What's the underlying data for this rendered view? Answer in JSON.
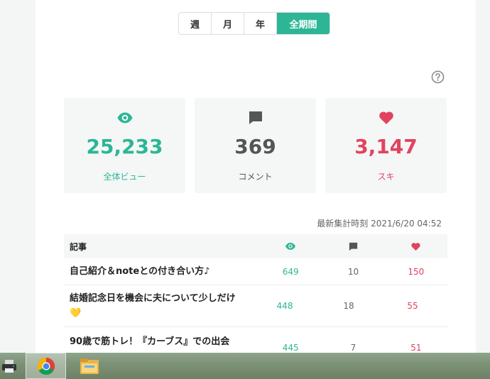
{
  "period_tabs": [
    {
      "label": "週",
      "active": false
    },
    {
      "label": "月",
      "active": false
    },
    {
      "label": "年",
      "active": false
    },
    {
      "label": "全期間",
      "active": true
    }
  ],
  "stats": {
    "views": {
      "value": "25,233",
      "label": "全体ビュー",
      "color": "#2cb696",
      "icon": "eye-icon"
    },
    "comments": {
      "value": "369",
      "label": "コメント",
      "color": "#555555",
      "icon": "comment-icon"
    },
    "likes": {
      "value": "3,147",
      "label": "スキ",
      "color": "#e0435f",
      "icon": "heart-icon"
    }
  },
  "timestamp": "最新集計時刻 2021/6/20 04:52",
  "table": {
    "header_title": "記事",
    "rows": [
      {
        "title": "自己紹介＆noteとの付き合い方♪",
        "views": "649",
        "comments": "10",
        "likes": "150"
      },
      {
        "title": "結婚記念日を機会に夫について少しだけ",
        "title_emoji": "💛",
        "views": "448",
        "comments": "18",
        "likes": "55"
      },
      {
        "title": "90歳で筋トレ！『カーブス』での出会",
        "views": "445",
        "comments": "7",
        "likes": "51"
      }
    ]
  },
  "taskbar": {
    "items": [
      "printer-icon",
      "chrome-icon",
      "file-explorer-icon"
    ]
  }
}
